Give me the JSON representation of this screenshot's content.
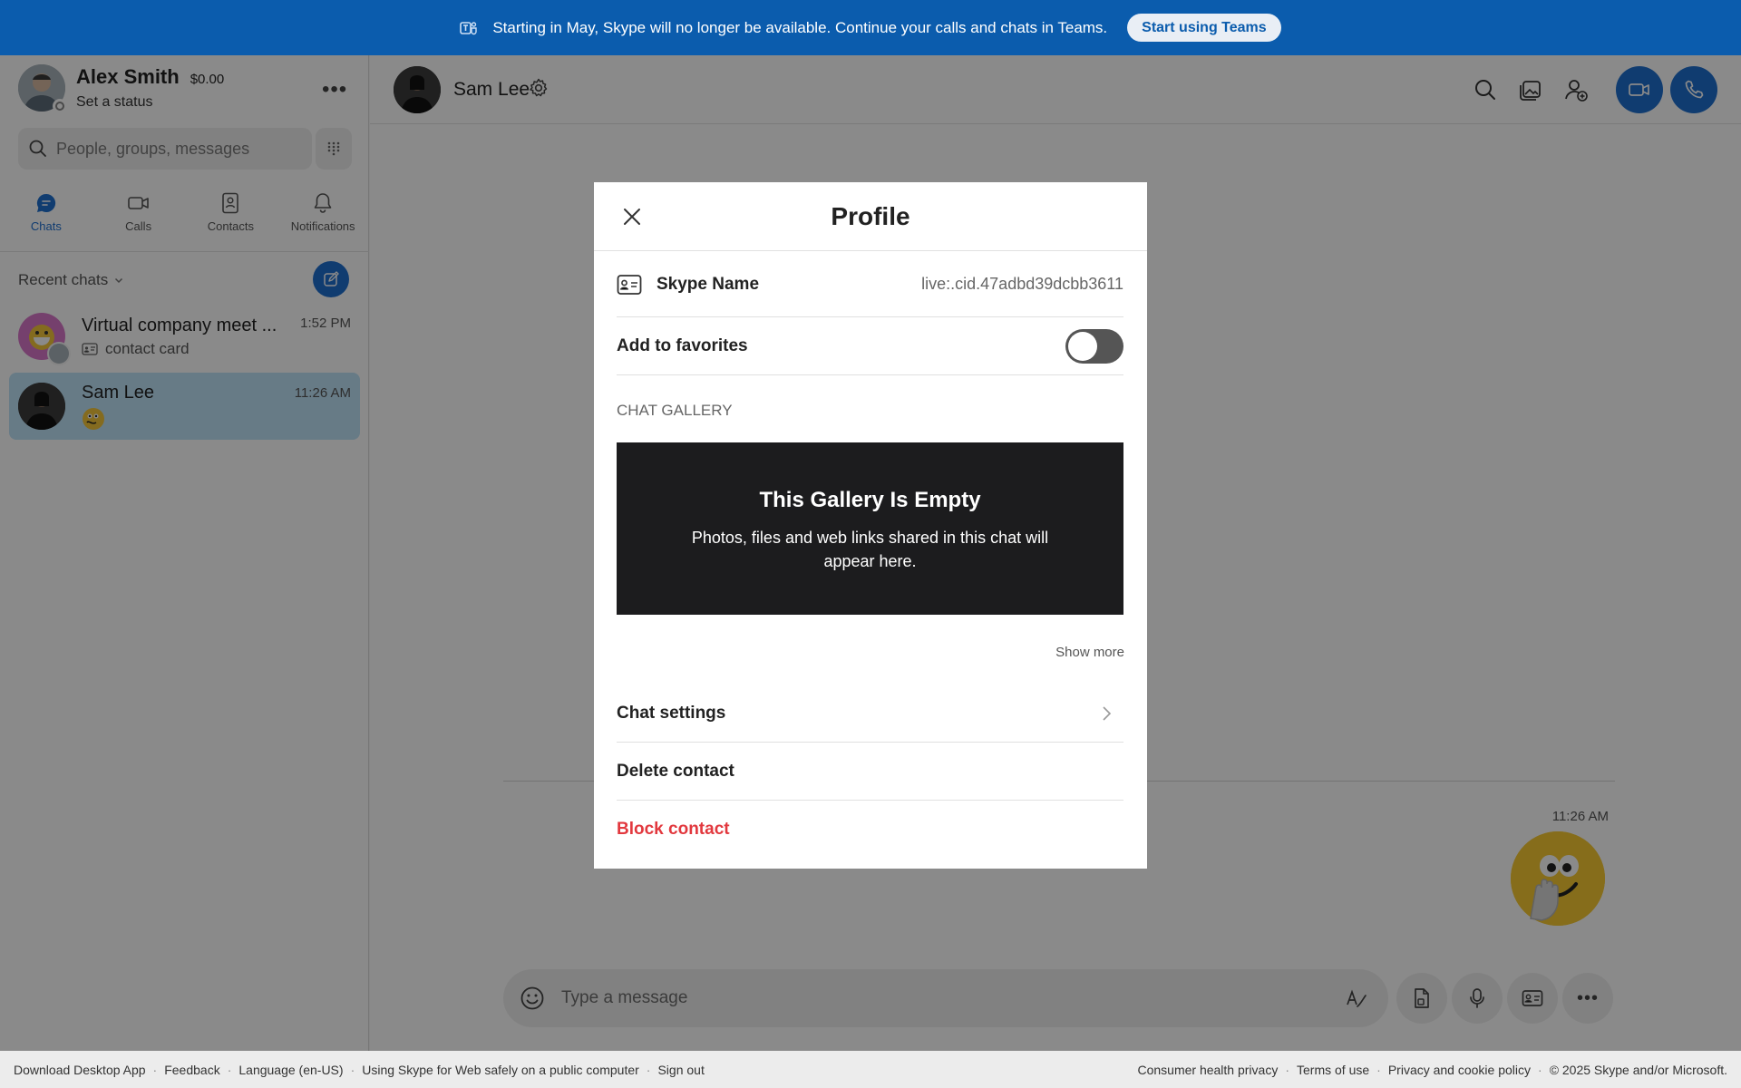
{
  "banner": {
    "message": "Starting in May, Skype will no longer be available. Continue your calls and chats in Teams.",
    "button": "Start using Teams"
  },
  "me": {
    "name": "Alex Smith",
    "credit": "$0.00",
    "status": "Set a status"
  },
  "search": {
    "placeholder": "People, groups, messages"
  },
  "nav": [
    {
      "label": "Chats",
      "icon": "chat-icon",
      "active": true
    },
    {
      "label": "Calls",
      "icon": "video-icon"
    },
    {
      "label": "Contacts",
      "icon": "contact-book-icon"
    },
    {
      "label": "Notifications",
      "icon": "bell-icon"
    }
  ],
  "recent": {
    "label": "Recent chats"
  },
  "chats": [
    {
      "name": "Virtual company meet ...",
      "sub": "contact card",
      "time": "1:52 PM"
    },
    {
      "name": "Sam Lee",
      "sub": "",
      "time": "11:26 AM"
    }
  ],
  "conversation": {
    "name": "Sam Lee",
    "message_time": "11:26 AM",
    "composer_placeholder": "Type a message"
  },
  "profile": {
    "title": "Profile",
    "skype_name_label": "Skype Name",
    "skype_name_value": "live:.cid.47adbd39dcbb3611",
    "favorites_label": "Add to favorites",
    "favorites_on": false,
    "gallery_title": "CHAT GALLERY",
    "gallery_empty_title": "This Gallery Is Empty",
    "gallery_empty_body": "Photos, files and web links shared in this chat will appear here.",
    "show_more": "Show more",
    "chat_settings": "Chat settings",
    "delete_contact": "Delete contact",
    "block_contact": "Block contact"
  },
  "footer": {
    "left": [
      "Download Desktop App",
      "Feedback",
      "Language (en-US)",
      "Using Skype for Web safely on a public computer",
      "Sign out"
    ],
    "right": [
      "Consumer health privacy",
      "Terms of use",
      "Privacy and cookie policy",
      "© 2025 Skype and/or Microsoft."
    ]
  },
  "colors": {
    "banner": "#0b5cad",
    "accent": "#1e6fd0",
    "selected_chat": "#bfe3f8",
    "danger": "#e2383e"
  }
}
